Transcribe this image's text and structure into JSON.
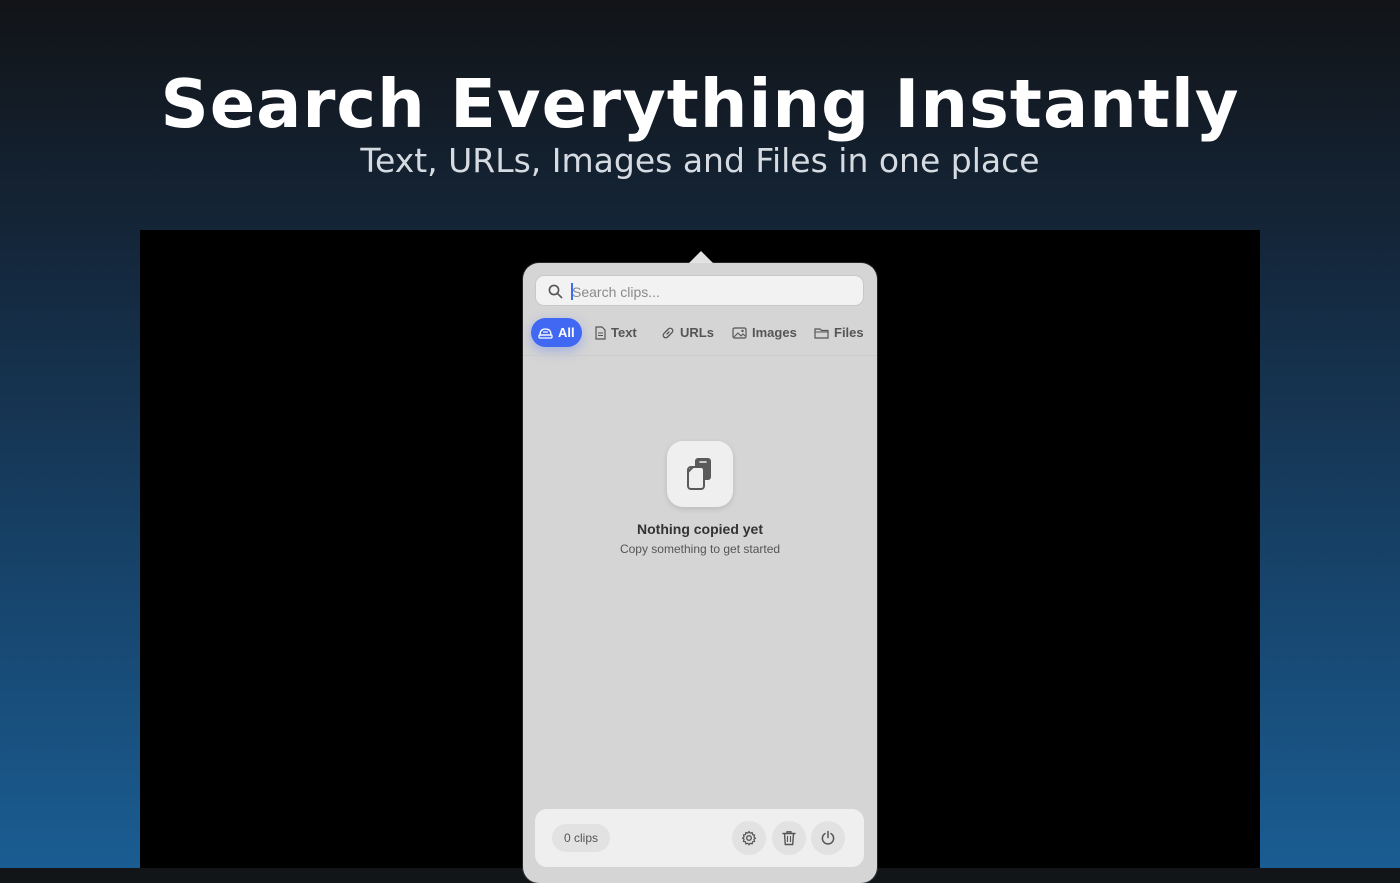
{
  "hero": {
    "title": "Search Everything Instantly",
    "subtitle": "Text, URLs, Images and Files in one place"
  },
  "popover": {
    "search": {
      "placeholder": "Search clips...",
      "value": ""
    },
    "tabs": [
      {
        "label": "All",
        "icon": "all-icon",
        "active": true
      },
      {
        "label": "Text",
        "icon": "document-icon",
        "active": false
      },
      {
        "label": "URLs",
        "icon": "link-icon",
        "active": false
      },
      {
        "label": "Images",
        "icon": "image-icon",
        "active": false
      },
      {
        "label": "Files",
        "icon": "folder-icon",
        "active": false
      }
    ],
    "empty_state": {
      "icon": "clipboard-icon",
      "title": "Nothing copied yet",
      "subtitle": "Copy something to get started"
    },
    "footer": {
      "clip_count": "0 clips",
      "buttons": [
        "settings-icon",
        "trash-icon",
        "power-icon"
      ]
    }
  },
  "colors": {
    "accent": "#4068f2",
    "popover_bg": "#d5d5d5",
    "screen_bg": "#000000"
  }
}
